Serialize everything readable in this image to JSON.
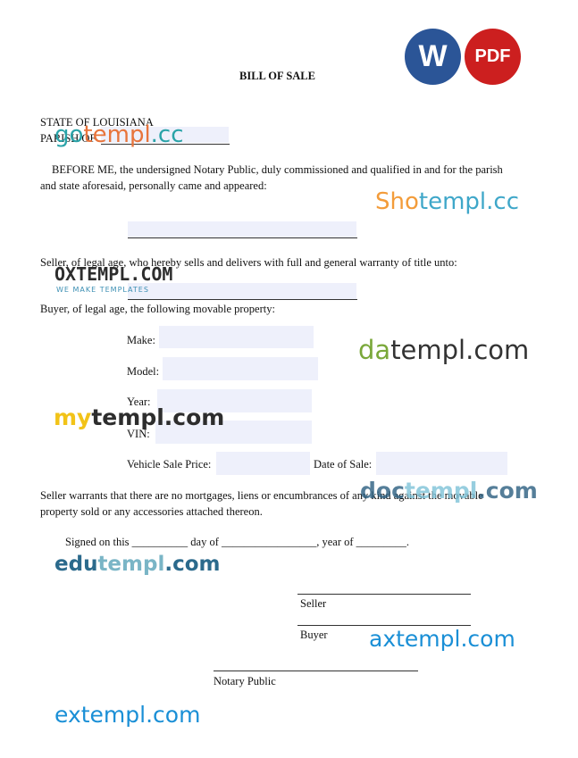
{
  "badges": {
    "word": "W",
    "pdf": "PDF",
    "word_color": "#2b5597",
    "pdf_color": "#cc1f1f"
  },
  "doc": {
    "title": "BILL OF SALE",
    "state": "STATE OF LOUISIANA",
    "parish": "PARISH OF",
    "para1_line1": "BEFORE ME, the undersigned Notary Public, duly commissioned and qualified in and for the parish",
    "para1_line2": "and state aforesaid, personally came and appeared:",
    "seller_line": "Seller, of legal age, who hereby sells and delivers with full and general warranty of title unto:",
    "buyer_line": "Buyer, of legal age, the following movable property:",
    "make_label": "Make:",
    "model_label": "Model:",
    "year_label": "Year:",
    "vin_label": "VIN:",
    "price_label": "Vehicle Sale Price:",
    "date_label": "Date of Sale:",
    "warrant_line1": "Seller warrants that there are no mortgages, liens or encumbrances of any kind against the movable",
    "warrant_line2": "property sold or any accessories attached thereon.",
    "signed_line": "Signed on this __________ day of _________________, year of _________.",
    "seller_sig": "Seller",
    "buyer_sig": "Buyer",
    "notary_sig": "Notary Public"
  },
  "watermarks": {
    "gotempl": {
      "a": "go",
      "b": "templ",
      "c": ".cc"
    },
    "shotempl": {
      "a": "Sho",
      "b": "templ",
      "c": ".cc"
    },
    "oxtempl": {
      "a": "OXTEMPL.COM",
      "tagline": "WE MAKE TEMPLATES"
    },
    "datempl": {
      "a": "da",
      "b": "templ.com"
    },
    "mytempl": {
      "a": "my",
      "b": "templ.com"
    },
    "doctempl": {
      "a": "doc",
      "b": "templ",
      "c": ".com"
    },
    "edutempl": {
      "a": "edu",
      "b": "templ",
      "c": ".com"
    },
    "axtempl": {
      "a": "ax",
      "b": "templ",
      "c": ".com"
    },
    "extempl": {
      "a": "ex",
      "b": "templ",
      "c": ".com"
    }
  }
}
